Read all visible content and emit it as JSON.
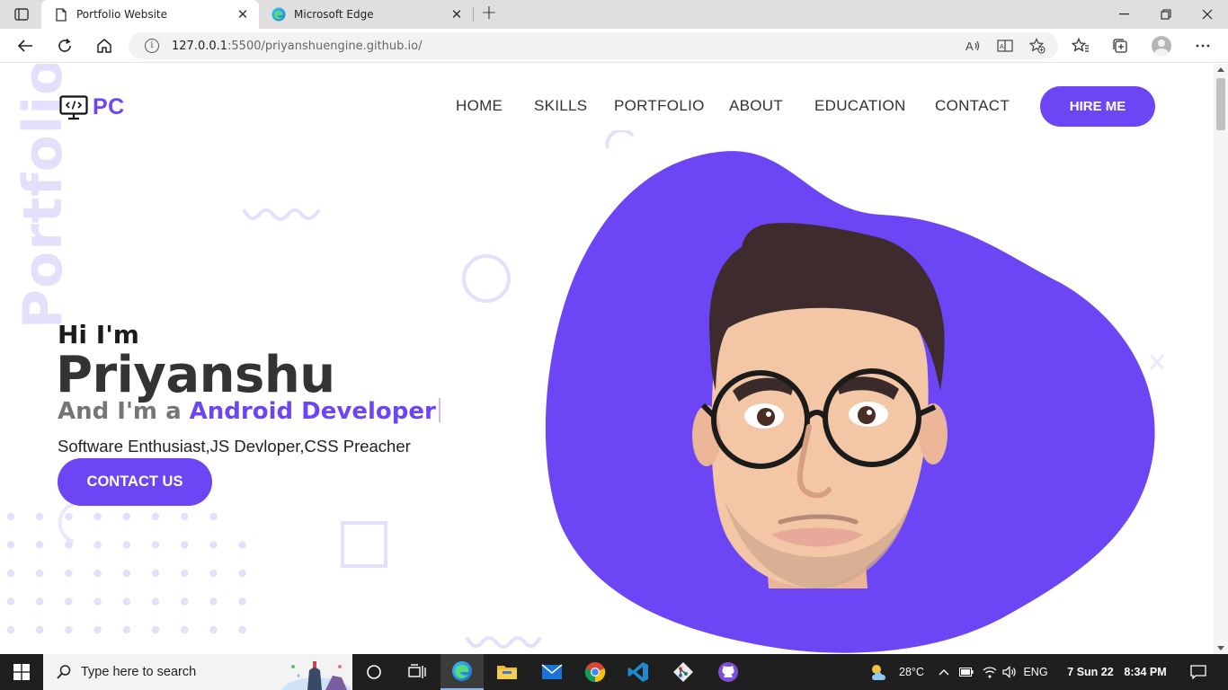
{
  "browser": {
    "tabs": [
      {
        "title": "Portfolio Website",
        "active": true,
        "icon": "page-icon"
      },
      {
        "title": "Microsoft Edge",
        "active": false,
        "icon": "edge-icon"
      }
    ],
    "address": {
      "host": "127.0.0.1",
      "path": ":5500/priyanshuengine.github.io/"
    }
  },
  "site": {
    "watermark": "Portfolio",
    "logo_text": "PC",
    "nav": [
      "HOME",
      "SKILLS",
      "PORTFOLIO",
      "ABOUT",
      "EDUCATION",
      "CONTACT"
    ],
    "hire_button": "HIRE ME",
    "hero": {
      "greeting": "Hi I'm",
      "name": "Priyanshu",
      "role_prefix": "And I'm a ",
      "role_highlight": "Android Developer",
      "subtitle": "Software Enthusiast,JS Devloper,CSS Preacher",
      "cta": "CONTACT US"
    },
    "colors": {
      "accent": "#6c45f5",
      "decoration": "#e4dffb"
    }
  },
  "taskbar": {
    "search_placeholder": "Type here to search",
    "weather": "28°C",
    "language": "ENG",
    "date": "7 Sun 22",
    "time": "8:34 PM",
    "pinned": [
      "task-view-icon",
      "edge-icon",
      "file-explorer-icon",
      "mail-icon",
      "chrome-icon",
      "vscode-icon",
      "git-icon",
      "github-icon"
    ]
  }
}
